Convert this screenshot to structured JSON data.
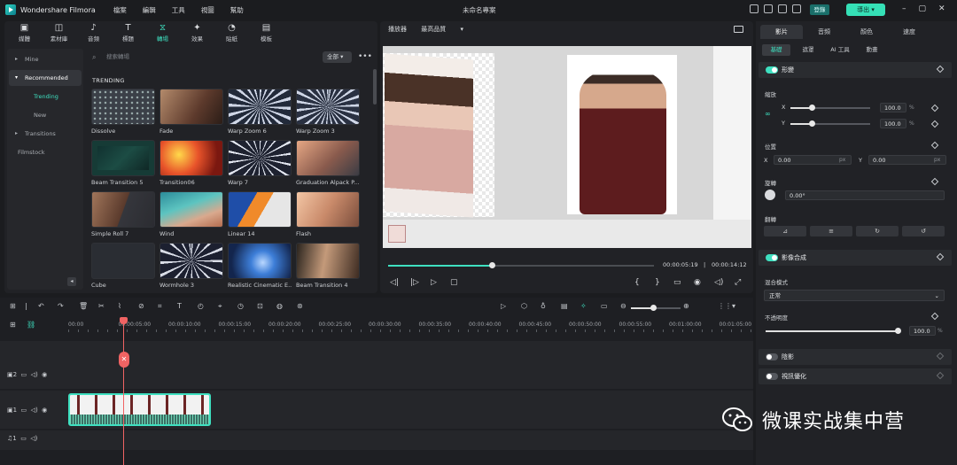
{
  "app": {
    "name": "Wondershare Filmora",
    "window_title": "未命名專案"
  },
  "menu": [
    "檔案",
    "編輯",
    "工具",
    "視圖",
    "幫助"
  ],
  "titlebar": {
    "login": "登錄",
    "export": "導出"
  },
  "media_tabs": [
    {
      "label": "媒體",
      "icon": "media-icon"
    },
    {
      "label": "素材庫",
      "icon": "stock-icon"
    },
    {
      "label": "音頻",
      "icon": "music-icon"
    },
    {
      "label": "標題",
      "icon": "title-icon"
    },
    {
      "label": "轉場",
      "icon": "transition-icon",
      "active": true
    },
    {
      "label": "效果",
      "icon": "effects-icon"
    },
    {
      "label": "貼紙",
      "icon": "sticker-icon"
    },
    {
      "label": "模板",
      "icon": "template-icon"
    }
  ],
  "sidebar": {
    "mine": "Mine",
    "recommended": "Recommended",
    "trending": "Trending",
    "new": "New",
    "transitions": "Transitions",
    "filmstock": "Filmstock"
  },
  "search": {
    "placeholder": "搜索轉場",
    "filter": "全部"
  },
  "section_title": "TRENDING",
  "transitions": [
    "Dissolve",
    "Fade",
    "Warp Zoom 6",
    "Warp Zoom 3",
    "Beam Transition 5",
    "Transition06",
    "Warp 7",
    "Graduation Alpack P...",
    "Simple Roll 7",
    "Wind",
    "Linear 14",
    "Flash",
    "Cube",
    "Wormhole 3",
    "Realistic Cinematic E...",
    "Beam Transition 4"
  ],
  "player": {
    "label": "播放器",
    "quality": "最高品質",
    "current_time": "00:00:05:19",
    "total_time": "00:00:14:12",
    "progress": 0.39
  },
  "right_panel": {
    "tabs": [
      "影片",
      "音頻",
      "顏色",
      "速度"
    ],
    "subtabs": [
      "基礎",
      "遮罩",
      "AI 工具",
      "動畫"
    ],
    "transform": "形變",
    "scale": "縮放",
    "scale_x": "100.0",
    "scale_y": "100.0",
    "x_label": "X",
    "y_label": "Y",
    "percent": "%",
    "position": "位置",
    "pos_x": "0.00",
    "pos_y": "0.00",
    "px": "px",
    "rotate": "旋轉",
    "rotate_value": "0.00°",
    "flip": "翻轉",
    "compositing": "影像合成",
    "blend_mode": "混合模式",
    "blend_value": "正常",
    "opacity": "不透明度",
    "opacity_value": "100.0",
    "shadow": "陰影",
    "auto_enhance": "視訊優化"
  },
  "ruler": [
    "00:00",
    "00:00:05:00",
    "00:00:10:00",
    "00:00:15:00",
    "00:00:20:00",
    "00:00:25:00",
    "00:00:30:00",
    "00:00:35:00",
    "00:00:40:00",
    "00:00:45:00",
    "00:00:50:00",
    "00:00:55:00",
    "00:01:00:00",
    "00:01:05:00"
  ],
  "tracks": {
    "video2": "2",
    "video1": "1",
    "audio1": "1"
  },
  "watermark": "微课实战集中营"
}
